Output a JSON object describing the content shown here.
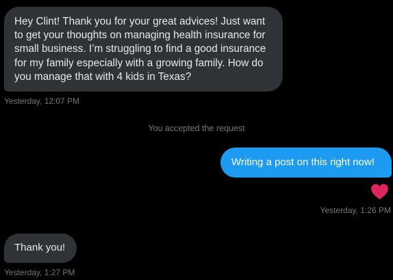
{
  "conversation": {
    "messages": [
      {
        "direction": "incoming",
        "text": "Hey Clint! Thank you for your great advices! Just want to get your thoughts on managing health insurance for small business. I’m struggling to find a good insurance for my family especially with a growing family. How do you manage that with 4 kids in Texas?",
        "timestamp": "Yesterday, 12:07 PM"
      },
      {
        "direction": "outgoing",
        "text": "Writing a post on this right now!",
        "timestamp": "Yesterday, 1:26 PM",
        "reaction_icon": "heart-icon"
      },
      {
        "direction": "incoming",
        "text": "Thank you!",
        "timestamp": "Yesterday, 1:27 PM"
      }
    ],
    "system_notice": "You accepted the request"
  },
  "colors": {
    "background": "#000000",
    "incoming_bubble": "#2f3336",
    "outgoing_bubble": "#1d9bf0",
    "timestamp_text": "#71767b",
    "heart": "#f91880"
  }
}
